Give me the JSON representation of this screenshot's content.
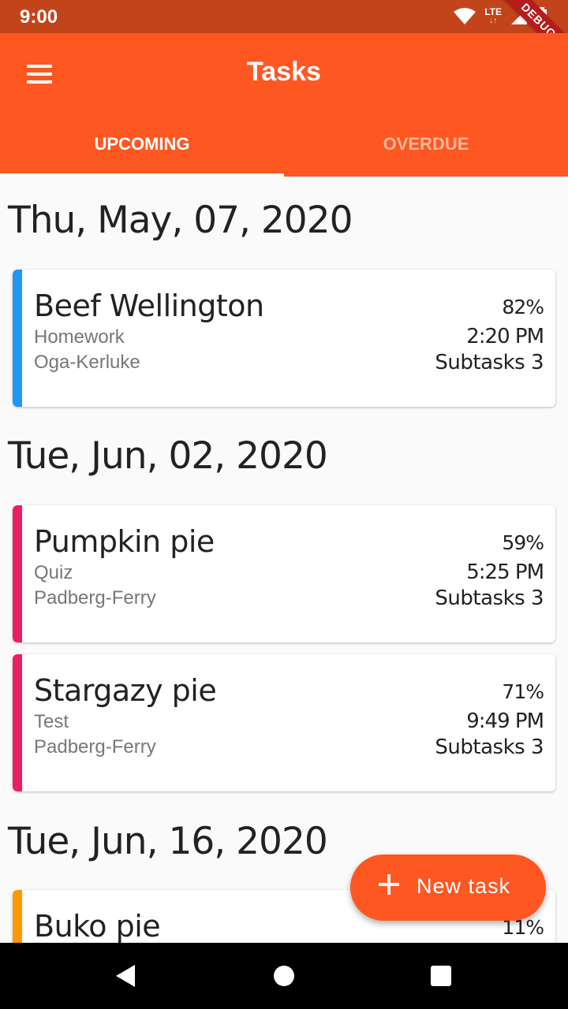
{
  "status_bar": {
    "time": "9:00",
    "network": "LTE",
    "icons": [
      "wifi-icon",
      "signal-icon",
      "battery-icon"
    ]
  },
  "debug_banner": "DEBUG",
  "app_bar": {
    "title": "Tasks",
    "menu_icon": "menu-icon",
    "color": "#fe5722"
  },
  "tabs": [
    {
      "label": "UPCOMING",
      "selected": true
    },
    {
      "label": "OVERDUE",
      "selected": false
    }
  ],
  "groups": [
    {
      "date": "Thu, May, 07, 2020",
      "tasks": [
        {
          "name": "Beef Wellington",
          "type": "Homework",
          "course": "Oga-Kerluke",
          "progress": "82%",
          "time": "2:20 PM",
          "subtasks": "Subtasks 3",
          "color": "#2196f3"
        }
      ]
    },
    {
      "date": "Tue, Jun, 02, 2020",
      "tasks": [
        {
          "name": "Pumpkin pie",
          "type": "Quiz",
          "course": "Padberg-Ferry",
          "progress": "59%",
          "time": "5:25 PM",
          "subtasks": "Subtasks 3",
          "color": "#e91e63"
        },
        {
          "name": "Stargazy pie",
          "type": "Test",
          "course": "Padberg-Ferry",
          "progress": "71%",
          "time": "9:49 PM",
          "subtasks": "Subtasks 3",
          "color": "#e91e63"
        }
      ]
    },
    {
      "date": "Tue, Jun, 16, 2020",
      "tasks": [
        {
          "name": "Buko pie",
          "progress": "11%",
          "color": "#ff9800"
        }
      ]
    }
  ],
  "fab": {
    "label": "New task",
    "icon": "plus-icon"
  },
  "nav_bar": {
    "icons": [
      "back-icon",
      "home-icon",
      "recents-icon"
    ]
  }
}
